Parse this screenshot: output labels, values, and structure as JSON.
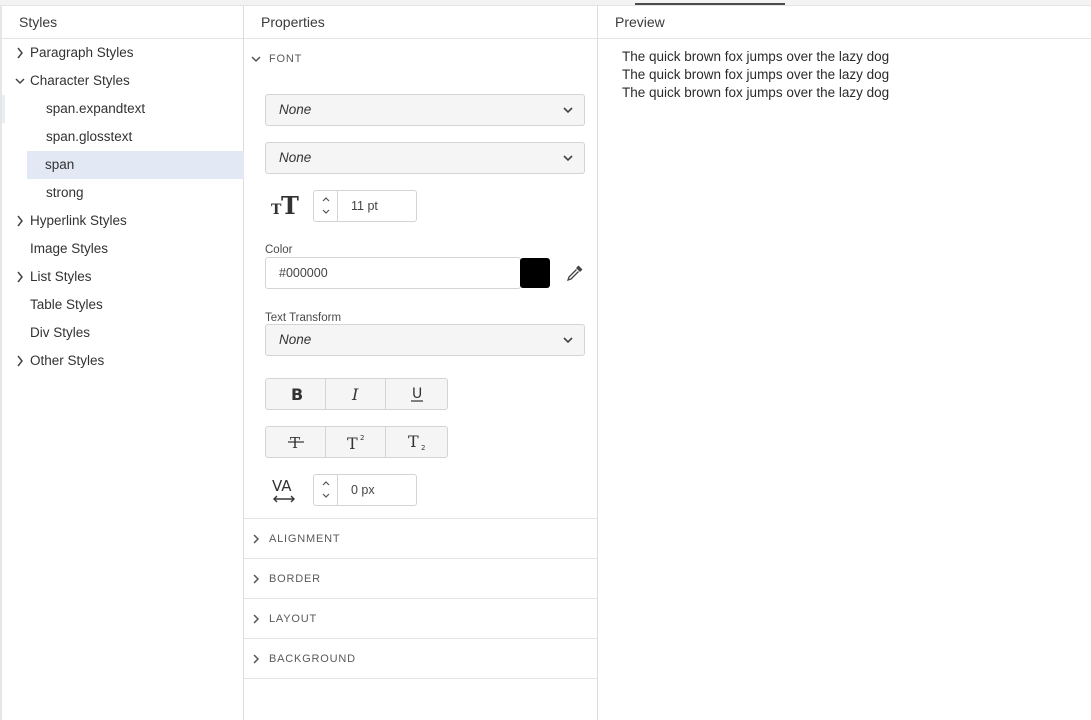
{
  "styles_panel": {
    "title": "Styles",
    "items": [
      {
        "label": "Paragraph Styles",
        "expanded": false,
        "has_children": true
      },
      {
        "label": "Character Styles",
        "expanded": true,
        "has_children": true
      },
      {
        "label": "span.expandtext",
        "child": true
      },
      {
        "label": "span.glosstext",
        "child": true
      },
      {
        "label": "span",
        "child": true,
        "selected": true
      },
      {
        "label": "strong",
        "child": true
      },
      {
        "label": "Hyperlink Styles",
        "expanded": false,
        "has_children": true
      },
      {
        "label": "Image Styles",
        "has_children": false
      },
      {
        "label": "List Styles",
        "expanded": false,
        "has_children": true
      },
      {
        "label": "Table Styles",
        "has_children": false
      },
      {
        "label": "Div Styles",
        "has_children": false
      },
      {
        "label": "Other Styles",
        "expanded": false,
        "has_children": true
      }
    ]
  },
  "properties_panel": {
    "title": "Properties",
    "font_section": {
      "title": "FONT",
      "font_family": "None",
      "font_weight": "None",
      "font_size": "11 pt",
      "color_label": "Color",
      "color_value": "#000000",
      "swatch_color": "#000000",
      "text_transform_label": "Text Transform",
      "text_transform": "None",
      "letter_spacing": "0 px"
    },
    "sections": [
      "ALIGNMENT",
      "BORDER",
      "LAYOUT",
      "BACKGROUND"
    ]
  },
  "preview_panel": {
    "title": "Preview",
    "lines": [
      "The quick brown fox jumps over the lazy dog",
      "The quick brown fox jumps over the lazy dog",
      "The quick brown fox jumps over the lazy dog"
    ]
  }
}
